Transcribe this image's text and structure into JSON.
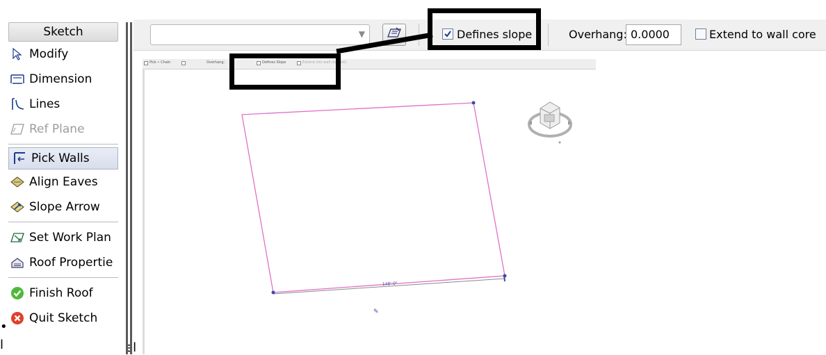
{
  "sidebar": {
    "header": "Sketch",
    "items": [
      {
        "label": "Modify",
        "icon": "cursor-arrow-icon",
        "disabled": false
      },
      {
        "label": "Dimension",
        "icon": "dimension-icon",
        "disabled": false
      },
      {
        "label": "Lines",
        "icon": "lines-icon",
        "disabled": false
      },
      {
        "label": "Ref Plane",
        "icon": "ref-plane-icon",
        "disabled": true
      },
      {
        "label": "Pick Walls",
        "icon": "pick-walls-icon",
        "disabled": false,
        "active": true
      },
      {
        "label": "Align Eaves",
        "icon": "align-eaves-icon",
        "disabled": false
      },
      {
        "label": "Slope Arrow",
        "icon": "slope-arrow-icon",
        "disabled": false
      },
      {
        "label": "Set Work Plan",
        "icon": "work-plane-icon",
        "disabled": false
      },
      {
        "label": "Roof Propertie",
        "icon": "roof-properties-icon",
        "disabled": false
      },
      {
        "label": "Finish Roof",
        "icon": "green-check-icon",
        "disabled": false
      },
      {
        "label": "Quit Sketch",
        "icon": "red-x-icon",
        "disabled": false
      }
    ],
    "bullet": "•",
    "bottom_left_text": "l",
    "bottom_right_text": "el"
  },
  "topbar": {
    "defines_slope_label": "Defines slope",
    "defines_slope_checked": true,
    "overhang_label": "Overhang:",
    "overhang_value": "0.0000",
    "extend_label": "Extend to wall core",
    "extend_checked": false
  },
  "small_toolbar": {
    "pick_chain": "Pick • Chain",
    "overhang": "Overhang:",
    "defines_slope": "Defines Slope",
    "extend": "Extend into wall (to core)"
  },
  "drawing": {
    "dimension_text": "148'-0\"",
    "marker": "✎",
    "colors": {
      "outline": "#e070c8",
      "dim_line": "#7a7a7a",
      "vertex": "#3b4aa8"
    }
  }
}
